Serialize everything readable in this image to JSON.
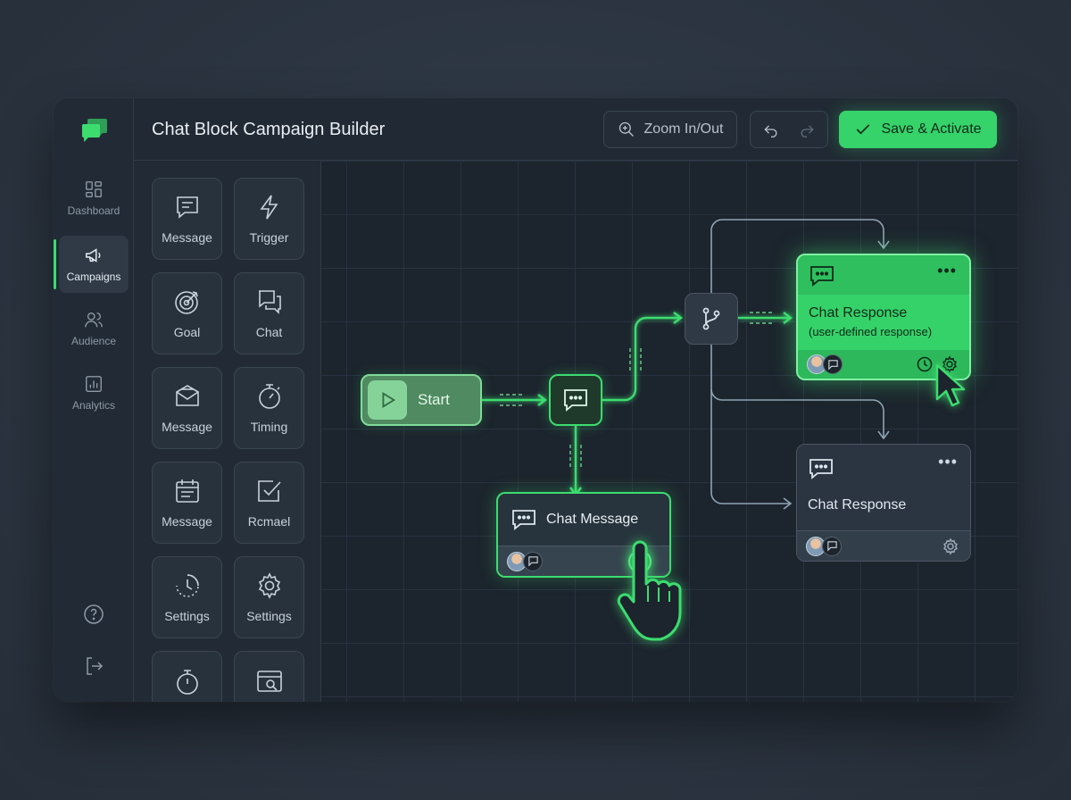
{
  "app": {
    "title": "Chat Block Campaign Builder",
    "accent": "#3ddc6f",
    "logo_icon": "chat-bubbles-logo"
  },
  "nav": {
    "items": [
      {
        "label": "Dashboard",
        "icon": "dashboard-grid-icon",
        "active": false
      },
      {
        "label": "Campaigns",
        "icon": "megaphone-icon",
        "active": true
      },
      {
        "label": "Audience",
        "icon": "users-icon",
        "active": false
      },
      {
        "label": "Analytics",
        "icon": "bar-chart-icon",
        "active": false
      }
    ],
    "help_icon": "help-icon",
    "logout_icon": "logout-icon"
  },
  "toolbar": {
    "zoom_label": "Zoom In/Out",
    "undo_icon": "undo-icon",
    "redo_icon": "redo-icon",
    "save_label": "Save & Activate"
  },
  "palette": {
    "tiles": [
      {
        "label": "Message",
        "icon": "message-icon"
      },
      {
        "label": "Trigger",
        "icon": "lightning-icon"
      },
      {
        "label": "Goal",
        "icon": "target-icon"
      },
      {
        "label": "Chat",
        "icon": "chat-icon"
      },
      {
        "label": "Message",
        "icon": "envelope-icon"
      },
      {
        "label": "Timing",
        "icon": "stopwatch-icon"
      },
      {
        "label": "Message",
        "icon": "calendar-icon"
      },
      {
        "label": "Rcmael",
        "icon": "checkbox-icon"
      },
      {
        "label": "Settings",
        "icon": "clock-icon"
      },
      {
        "label": "Settings",
        "icon": "gear-icon"
      },
      {
        "label": "",
        "icon": "stopwatch-icon"
      },
      {
        "label": "",
        "icon": "browser-search-icon"
      }
    ]
  },
  "canvas": {
    "start_node": {
      "label": "Start"
    },
    "chat_message_card": {
      "title": "Chat Message"
    },
    "response_card_active": {
      "title": "Chat Response",
      "subtitle": "(user-defined response)"
    },
    "response_card": {
      "title": "Chat Response"
    }
  }
}
